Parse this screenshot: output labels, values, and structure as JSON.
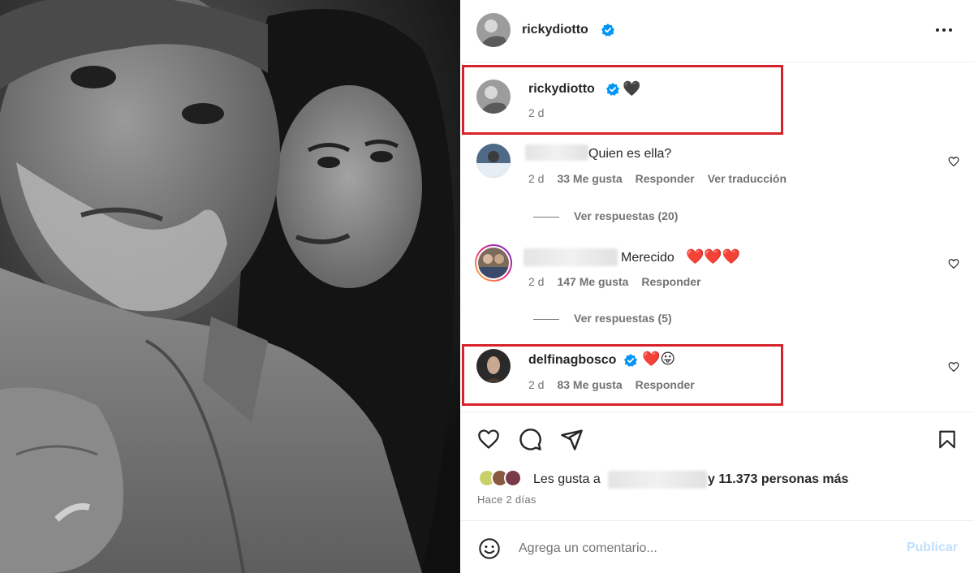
{
  "header": {
    "username": "rickydiotto",
    "verified": true,
    "more_icon": "more-horizontal-icon"
  },
  "caption": {
    "username": "rickydiotto",
    "emoji": "🖤",
    "time": "2 d"
  },
  "comments": [
    {
      "text": "Quien es ella?",
      "time": "2 d",
      "likes": "33 Me gusta",
      "reply": "Responder",
      "translate": "Ver traducción",
      "view_replies": "Ver respuestas (20)"
    },
    {
      "text": "Merecido",
      "emoji": "❤️❤️❤️",
      "time": "2 d",
      "likes": "147 Me gusta",
      "reply": "Responder",
      "view_replies": "Ver respuestas (5)"
    },
    {
      "username": "delfinagbosco",
      "emoji": "❤️😛",
      "time": "2 d",
      "likes": "83 Me gusta",
      "reply": "Responder"
    }
  ],
  "actions": {
    "like": "heart-icon",
    "comment": "comment-icon",
    "share": "share-icon",
    "save": "bookmark-icon"
  },
  "likes": {
    "prefix": "Les gusta a",
    "suffix": "y 11.373 personas más"
  },
  "time_ago": "Hace 2 días",
  "comment_box": {
    "placeholder": "Agrega un comentario...",
    "publish": "Publicar",
    "emoji_icon": "smiley-icon"
  },
  "colors": {
    "verified": "#0095f6",
    "highlight": "#d6232b",
    "publish_disabled": "#c0dffd",
    "muted": "#737373"
  }
}
